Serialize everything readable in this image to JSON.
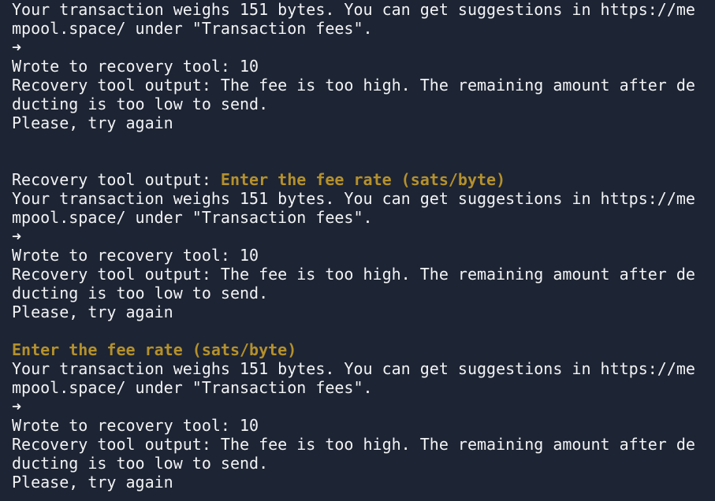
{
  "terminal": {
    "lines": [
      {
        "prefix": "",
        "highlight": "",
        "text": "Your transaction weighs 151 bytes. You can get suggestions in https://me"
      },
      {
        "prefix": "",
        "highlight": "",
        "text": "mpool.space/ under \"Transaction fees\"."
      },
      {
        "prefix": "",
        "highlight": "",
        "text": "➜"
      },
      {
        "prefix": "",
        "highlight": "",
        "text": "Wrote to recovery tool: 10"
      },
      {
        "prefix": "",
        "highlight": "",
        "text": "Recovery tool output: The fee is too high. The remaining amount after de"
      },
      {
        "prefix": "",
        "highlight": "",
        "text": "ducting is too low to send."
      },
      {
        "prefix": "",
        "highlight": "",
        "text": "Please, try again"
      },
      {
        "prefix": "",
        "highlight": "",
        "text": ""
      },
      {
        "prefix": "",
        "highlight": "",
        "text": ""
      },
      {
        "prefix": "Recovery tool output: ",
        "highlight": "Enter the fee rate (sats/byte)",
        "text": ""
      },
      {
        "prefix": "",
        "highlight": "",
        "text": "Your transaction weighs 151 bytes. You can get suggestions in https://me"
      },
      {
        "prefix": "",
        "highlight": "",
        "text": "mpool.space/ under \"Transaction fees\"."
      },
      {
        "prefix": "",
        "highlight": "",
        "text": "➜"
      },
      {
        "prefix": "",
        "highlight": "",
        "text": "Wrote to recovery tool: 10"
      },
      {
        "prefix": "",
        "highlight": "",
        "text": "Recovery tool output: The fee is too high. The remaining amount after de"
      },
      {
        "prefix": "",
        "highlight": "",
        "text": "ducting is too low to send."
      },
      {
        "prefix": "",
        "highlight": "",
        "text": "Please, try again"
      },
      {
        "prefix": "",
        "highlight": "",
        "text": ""
      },
      {
        "prefix": "",
        "highlight": "Enter the fee rate (sats/byte)",
        "text": ""
      },
      {
        "prefix": "",
        "highlight": "",
        "text": "Your transaction weighs 151 bytes. You can get suggestions in https://me"
      },
      {
        "prefix": "",
        "highlight": "",
        "text": "mpool.space/ under \"Transaction fees\"."
      },
      {
        "prefix": "",
        "highlight": "",
        "text": "➜"
      },
      {
        "prefix": "",
        "highlight": "",
        "text": "Wrote to recovery tool: 10"
      },
      {
        "prefix": "",
        "highlight": "",
        "text": "Recovery tool output: The fee is too high. The remaining amount after de"
      },
      {
        "prefix": "",
        "highlight": "",
        "text": "ducting is too low to send."
      },
      {
        "prefix": "",
        "highlight": "",
        "text": "Please, try again"
      }
    ]
  },
  "colors": {
    "background": "#1d2433",
    "text": "#f2f3f5",
    "highlight": "#b5912c"
  }
}
